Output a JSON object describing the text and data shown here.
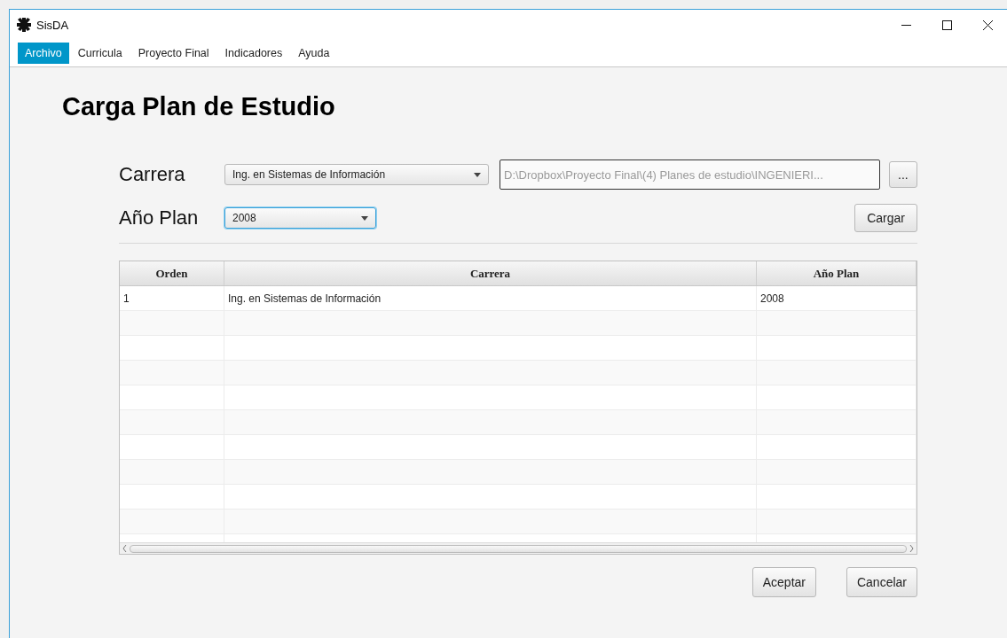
{
  "window": {
    "title": "SisDA"
  },
  "menu": [
    {
      "label": "Archivo",
      "selected": true
    },
    {
      "label": "Curricula",
      "selected": false
    },
    {
      "label": "Proyecto Final",
      "selected": false
    },
    {
      "label": "Indicadores",
      "selected": false
    },
    {
      "label": "Ayuda",
      "selected": false
    }
  ],
  "heading": "Carga Plan de Estudio",
  "form": {
    "carrera_label": "Carrera",
    "carrera_value": "Ing. en Sistemas de Información",
    "path_value": "D:\\Dropbox\\Proyecto Final\\(4) Planes de estudio\\INGENIERI...",
    "browse_button": "...",
    "anio_label": "Año Plan",
    "anio_value": "2008",
    "anio_focused": true,
    "load_button": "Cargar"
  },
  "table": {
    "columns": [
      "Orden",
      "Carrera",
      "Año Plan"
    ],
    "rows": [
      [
        "1",
        "Ing. en Sistemas de Información",
        "2008"
      ]
    ]
  },
  "buttons": [
    "Aceptar",
    "Cancelar"
  ]
}
